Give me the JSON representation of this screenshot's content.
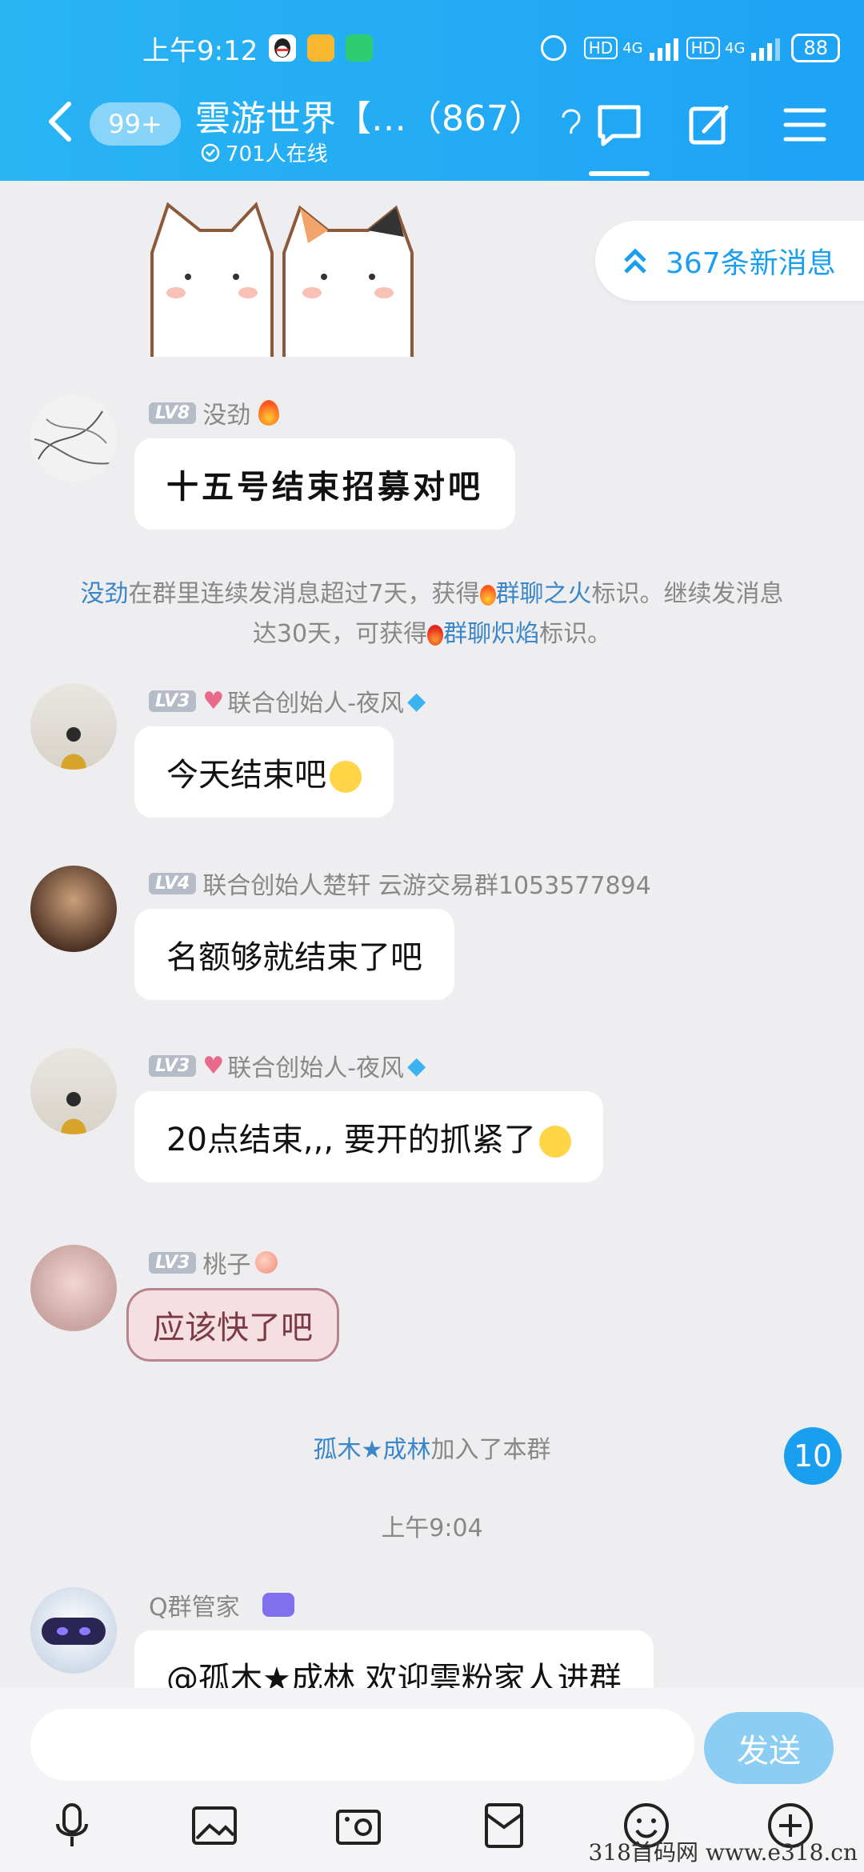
{
  "status_bar": {
    "time": "上午9:12",
    "net1": "HD",
    "g1": "4G",
    "net2": "HD",
    "g2": "4G",
    "battery": "88"
  },
  "header": {
    "unread": "99+",
    "title": "雲游世界【…（867）",
    "online": "701人在线"
  },
  "new_messages": "367条新消息",
  "messages": [
    {
      "level": "LV8",
      "name": "没劲",
      "text": "十五号结束招募对吧"
    },
    {
      "level": "LV3",
      "name": "联合创始人-夜风",
      "text": "今天结束吧"
    },
    {
      "level": "LV4",
      "name": "联合创始人楚轩 云游交易群1053577894",
      "text": "名额够就结束了吧"
    },
    {
      "level": "LV3",
      "name": "联合创始人-夜风",
      "text": "20点结束,,, 要开的抓紧了"
    },
    {
      "level": "LV3",
      "name": "桃子",
      "text": "应该快了吧"
    },
    {
      "level": "",
      "name": "Q群管家",
      "text": "@孤木★成林 欢迎雲粉家人进群"
    }
  ],
  "system": {
    "fire_user": "没劲",
    "fire_p1": "在群里连续发消息超过7天，获得",
    "fire_badge1": "群聊之火",
    "fire_p2": "标识。继续发消息",
    "fire_p3": "达30天，可获得",
    "fire_badge2": "群聊炽焰",
    "fire_p4": "标识。",
    "join_user": "孤木★成林",
    "join_text": "加入了本群",
    "timestamp": "上午9:04"
  },
  "unread_count": "10",
  "input": {
    "placeholder": "",
    "send": "发送"
  },
  "watermark": "318首码网 www.e318.cn",
  "colors": {
    "header": "#1ea3f5",
    "accent": "#1a9ff0",
    "link": "#3a86c8",
    "background": "#eeeef0"
  }
}
